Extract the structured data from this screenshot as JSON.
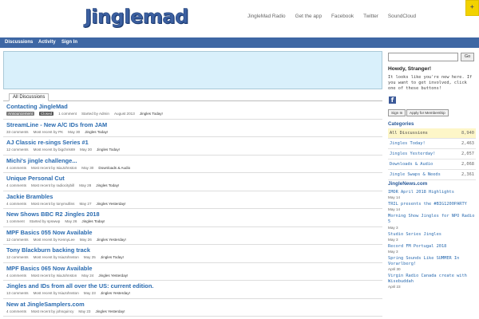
{
  "header": {
    "logo_text": "Jinglemad",
    "nav": [
      "JingleMad Radio",
      "Get the app",
      "Facebook",
      "Twitter",
      "SoundCloud"
    ],
    "ribbon_icon": "plus"
  },
  "navbar": {
    "items": [
      "Discussions",
      "Activity",
      "Sign In"
    ]
  },
  "tabs": {
    "active": "All Discussions"
  },
  "discussions": [
    {
      "title": "Contacting JingleMad",
      "announcement": "Announcement",
      "closed": "Closed",
      "comments": "1 comment",
      "recent": "Started by",
      "user": "Admin",
      "date": "August 2013",
      "category": "Jingles Today!"
    },
    {
      "title": "StreamLine - New A/C IDs from JAM",
      "comments": "33 comments",
      "recent": "Most recent by",
      "user": "PK",
      "date": "May 30",
      "category": "Jingles Today!"
    },
    {
      "title": "AJ Classic re-sings Series #1",
      "comments": "12 comments",
      "recent": "Most recent by",
      "user": "bigchris69",
      "date": "May 30",
      "category": "Jingles Today!"
    },
    {
      "title": "Michi's jingle challenge...",
      "comments": "4 comments",
      "recent": "Most recent by",
      "user": "IsiaJohnston",
      "date": "May 30",
      "category": "Downloads & Audio"
    },
    {
      "title": "Unique Personal Cut",
      "comments": "4 comments",
      "recent": "Most recent by",
      "user": "radiocitybill",
      "date": "May 28",
      "category": "Jingles Today!"
    },
    {
      "title": "Jackie Brambles",
      "comments": "4 comments",
      "recent": "Most recent by",
      "user": "tonymullins",
      "date": "May 27",
      "category": "Jingles Yesterday!"
    },
    {
      "title": "New Shows BBC R2 Jingles 2018",
      "comments": "1 comment",
      "recent": "Started by",
      "user": "spswwp",
      "date": "May 26",
      "category": "Jingles Today!"
    },
    {
      "title": "MPF Basics 055 Now Available",
      "comments": "12 comments",
      "recent": "Most recent by",
      "user": "KennyLee",
      "date": "May 26",
      "category": "Jingles Yesterday!"
    },
    {
      "title": "Tony Blackburn backing track",
      "comments": "12 comments",
      "recent": "Most recent by",
      "user": "IsiaJohnston",
      "date": "May 25",
      "category": "Jingles Today!"
    },
    {
      "title": "MPF Basics 065 Now Available",
      "comments": "4 comments",
      "recent": "Most recent by",
      "user": "IsiaJohnston",
      "date": "May 24",
      "category": "Jingles Yesterday!"
    },
    {
      "title": "Jingles and IDs from all over the US: current edition.",
      "comments": "13 comments",
      "recent": "Most recent by",
      "user": "IsiaJohnston",
      "date": "May 23",
      "category": "Jingles Yesterday!"
    },
    {
      "title": "New at JingleSamplers.com",
      "comments": "4 comments",
      "recent": "Most recent by",
      "user": "johnquincy",
      "date": "May 23",
      "category": "Jingles Yesterday!"
    }
  ],
  "sidebar": {
    "search_placeholder": "",
    "go_label": "Go",
    "howdy": "Howdy, Stranger!",
    "invite": "It looks like you're new here. If you want to get involved, click one of these buttons!",
    "facebook_glyph": "f",
    "sign_in": "Sign In",
    "apply": "Apply for Membership",
    "categories_heading": "Categories",
    "categories": [
      {
        "name": "All Discussions",
        "count": "8,940"
      },
      {
        "name": "Jingles Today!",
        "count": "2,463"
      },
      {
        "name": "Jingles Yesterday!",
        "count": "2,057"
      },
      {
        "name": "Downloads & Audio",
        "count": "2,068"
      },
      {
        "name": "Jingle Swaps & Needs",
        "count": "2,361"
      }
    ],
    "news_heading": "JingleNews.com",
    "news": [
      {
        "title": "IMOR April 2018 Highlights",
        "date": "May 14"
      },
      {
        "title": "TRIL presents the #BIG1200PARTY",
        "date": "May 14"
      },
      {
        "title": "Morning Show Jingles for NPO Radio 5",
        "date": "May 3"
      },
      {
        "title": "Studio Series Jingles",
        "date": "May 3"
      },
      {
        "title": "Record FM Portugal 2018",
        "date": "May 3"
      },
      {
        "title": "Spring Sounds Like SUMMER In Vorarlberg!",
        "date": "April 30"
      },
      {
        "title": "Virgin Radio Canada create with Wisebuddah",
        "date": "April 23"
      }
    ]
  }
}
